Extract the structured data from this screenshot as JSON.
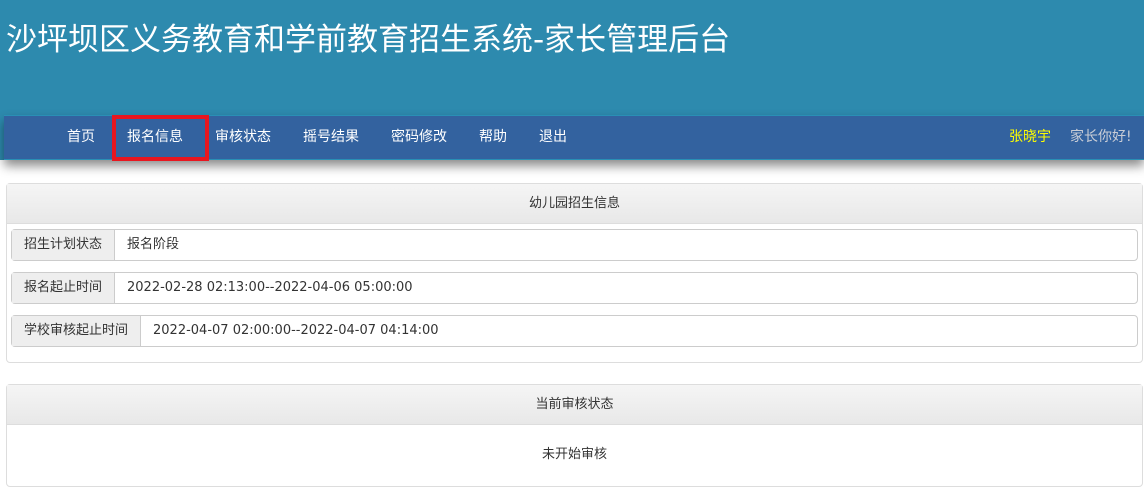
{
  "header": {
    "title": "沙坪坝区义务教育和学前教育招生系统-家长管理后台"
  },
  "nav": {
    "items": [
      "首页",
      "报名信息",
      "审核状态",
      "摇号结果",
      "密码修改",
      "帮助",
      "退出"
    ],
    "active": "报名信息",
    "user": "张晓宇",
    "greeting": "家长你好!"
  },
  "info_panel": {
    "title": "幼儿园招生信息",
    "rows": [
      {
        "label": "招生计划状态",
        "value": "报名阶段"
      },
      {
        "label": "报名起止时间",
        "value": "2022-02-28 02:13:00--2022-04-06 05:00:00"
      },
      {
        "label": "学校审核起止时间",
        "value": "2022-04-07 02:00:00--2022-04-07 04:14:00"
      }
    ]
  },
  "status_panel": {
    "title": "当前审核状态",
    "value": "未开始审核"
  }
}
